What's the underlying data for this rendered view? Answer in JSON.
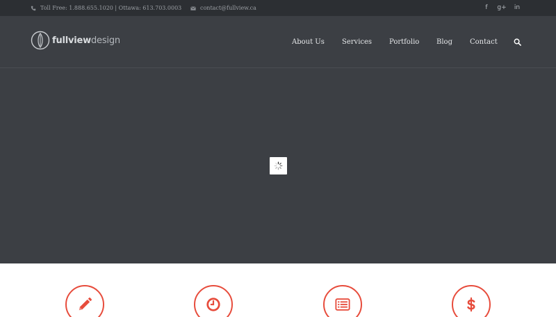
{
  "topbar": {
    "phone_text": "Toll Free: 1.888.655.1020 | Ottawa: 613.703.0003",
    "email_text": "contact@fullview.ca",
    "social": [
      {
        "icon": "facebook-icon",
        "glyph": "f"
      },
      {
        "icon": "google-plus-icon",
        "glyph": "g+"
      },
      {
        "icon": "linkedin-icon",
        "glyph": "in"
      }
    ]
  },
  "header": {
    "logo_word1": "fullview",
    "logo_word2": "design",
    "nav": [
      "About Us",
      "Services",
      "Portfolio",
      "Blog",
      "Contact"
    ]
  },
  "features": [
    {
      "icon": "pencil-icon"
    },
    {
      "icon": "clock-icon"
    },
    {
      "icon": "list-icon"
    },
    {
      "icon": "dollar-icon"
    }
  ],
  "colors": {
    "topbar_bg": "#2c2f33",
    "header_bg": "#3c3f44",
    "accent": "#e74c3c"
  }
}
